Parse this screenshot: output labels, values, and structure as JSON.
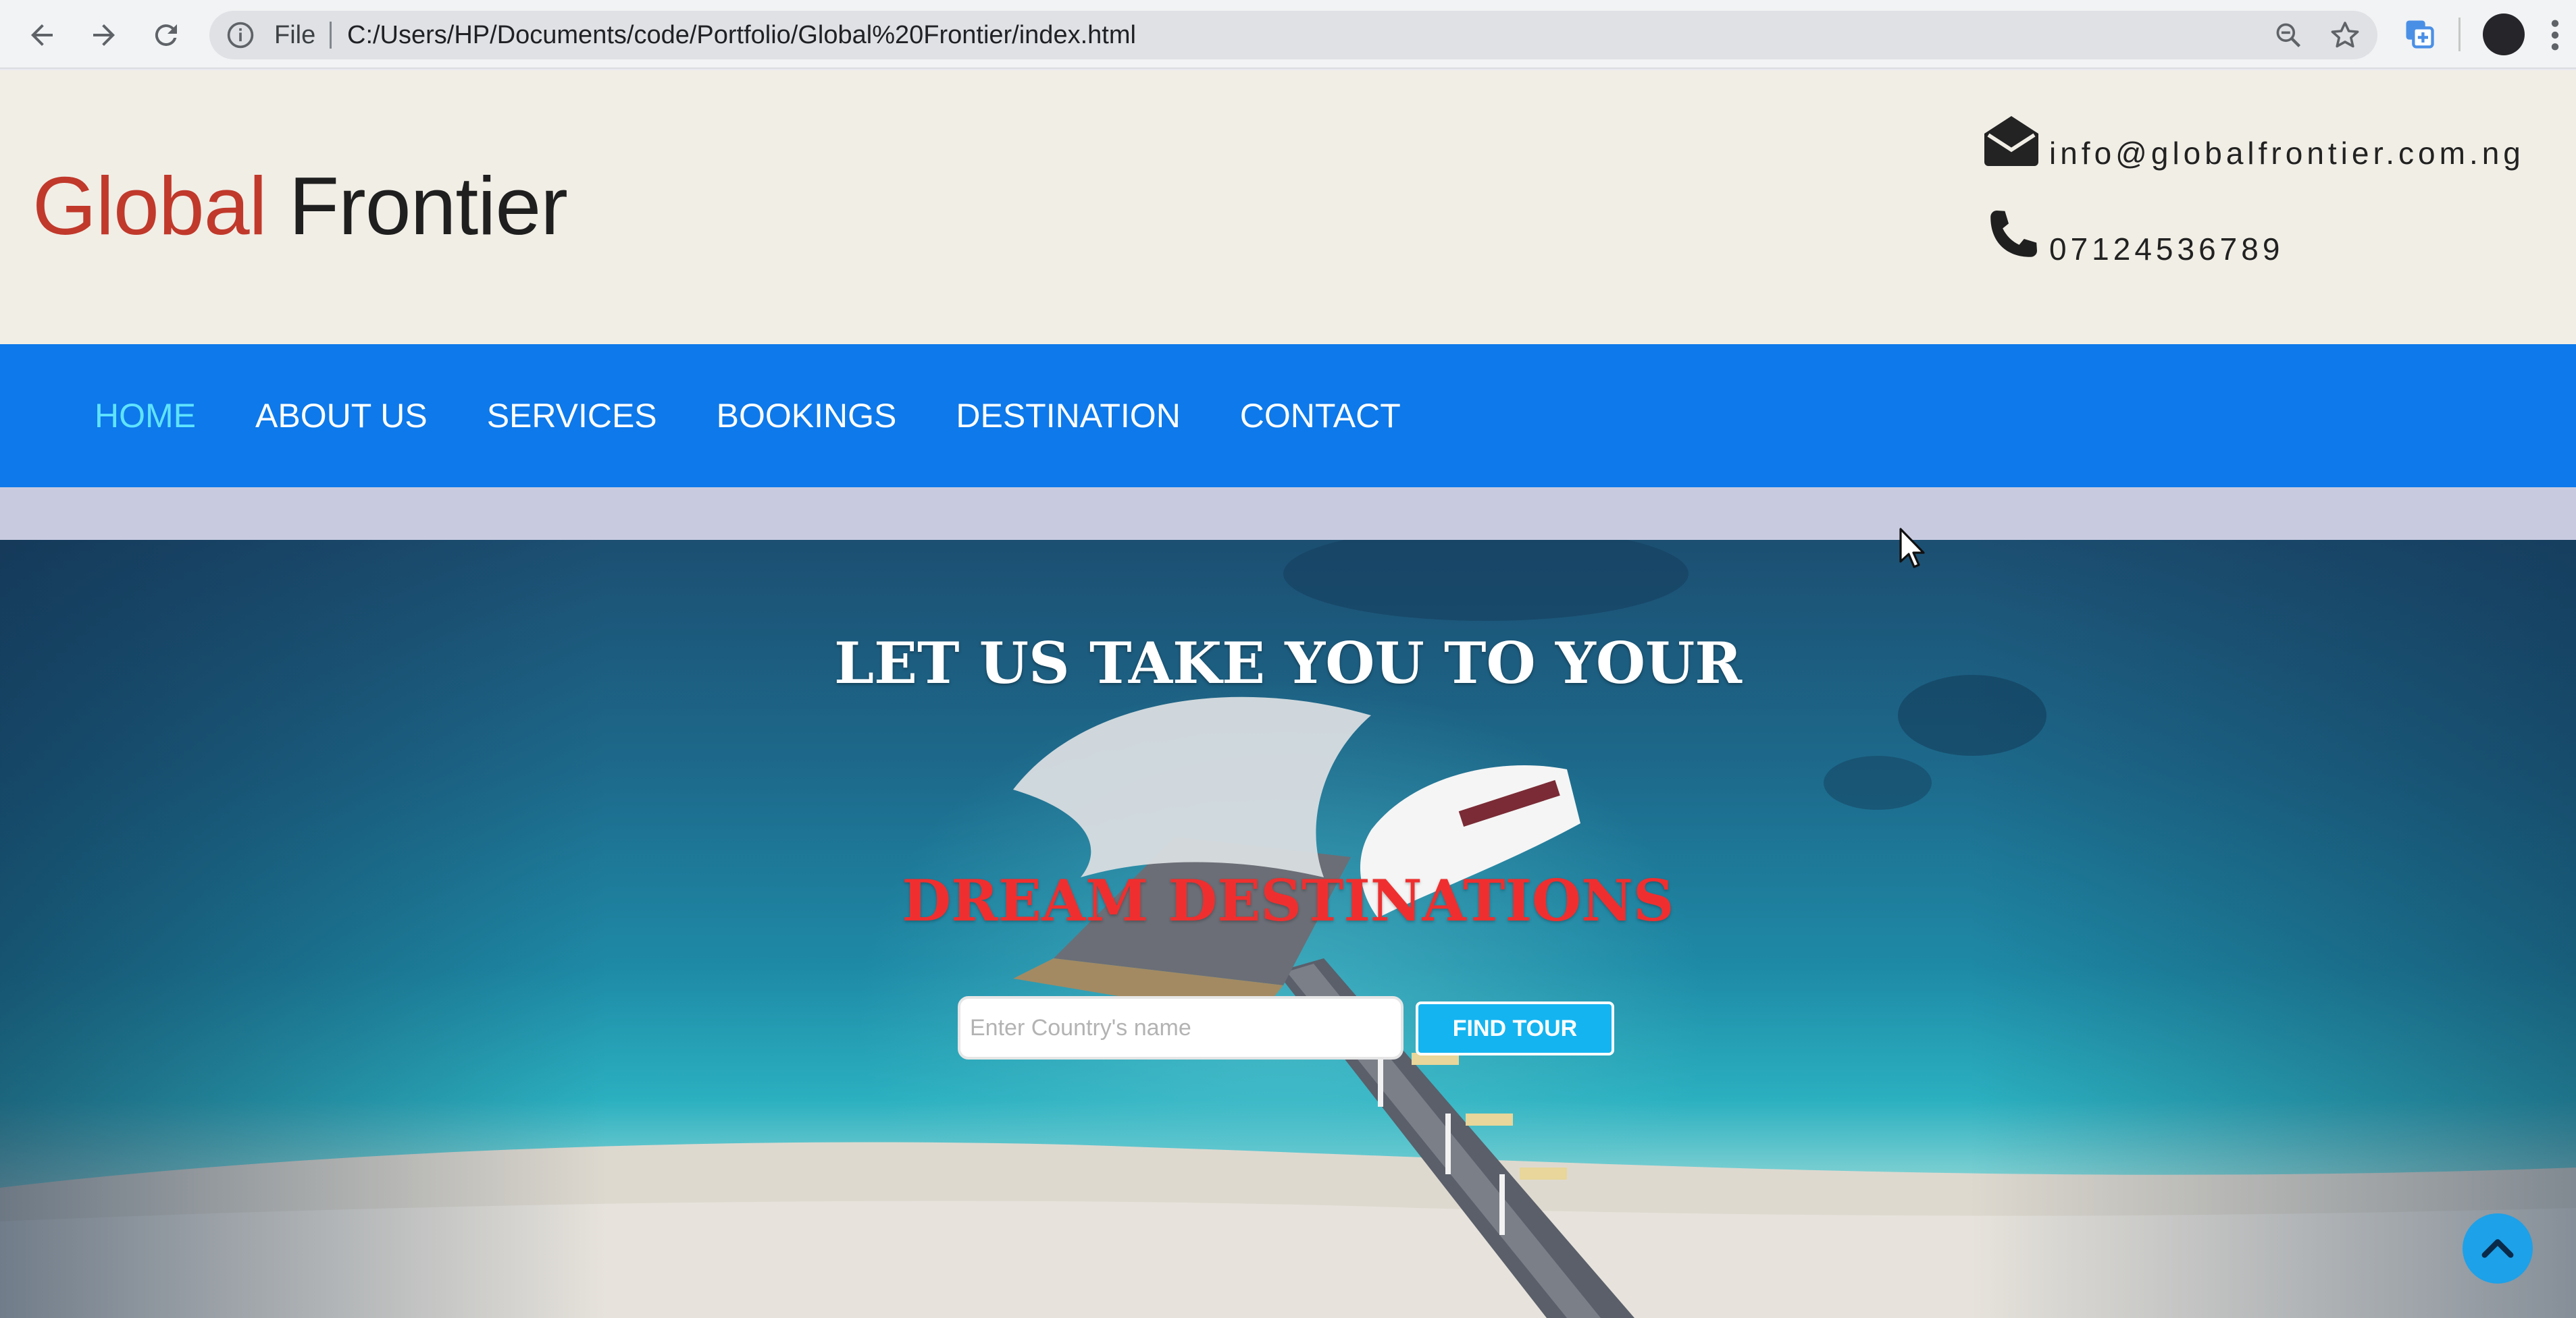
{
  "browser": {
    "scheme_label": "File",
    "url": "C:/Users/HP/Documents/code/Portfolio/Global%20Frontier/index.html"
  },
  "site": {
    "logo_part1": "Global",
    "logo_part2": "Frontier",
    "email": "info@globalfrontier.com.ng",
    "phone": "07124536789"
  },
  "nav": {
    "items": [
      {
        "label": "HOME",
        "active": true
      },
      {
        "label": "ABOUT US",
        "active": false
      },
      {
        "label": "SERVICES",
        "active": false
      },
      {
        "label": "BOOKINGS",
        "active": false
      },
      {
        "label": "DESTINATION",
        "active": false
      },
      {
        "label": "CONTACT",
        "active": false
      }
    ]
  },
  "hero": {
    "headline_line1": "LET US TAKE YOU TO YOUR",
    "headline_line2": "DREAM DESTINATIONS",
    "search_placeholder": "Enter Country's name",
    "button_label": "FIND TOUR"
  },
  "icons": {
    "back": "arrow-left-icon",
    "forward": "arrow-right-icon",
    "reload": "reload-icon",
    "info": "info-icon",
    "zoom": "zoom-out-icon",
    "bookmark": "star-icon",
    "extension": "extension-icon",
    "menu": "kebab-menu-icon",
    "email": "envelope-icon",
    "phone": "phone-icon",
    "scroll_top": "chevron-up-icon"
  },
  "colors": {
    "nav_bg": "#0d79ea",
    "nav_active": "#5fe3ff",
    "logo_accent": "#c0392b",
    "headline_accent": "#ef2f2f",
    "button_bg": "#14b4f0"
  }
}
